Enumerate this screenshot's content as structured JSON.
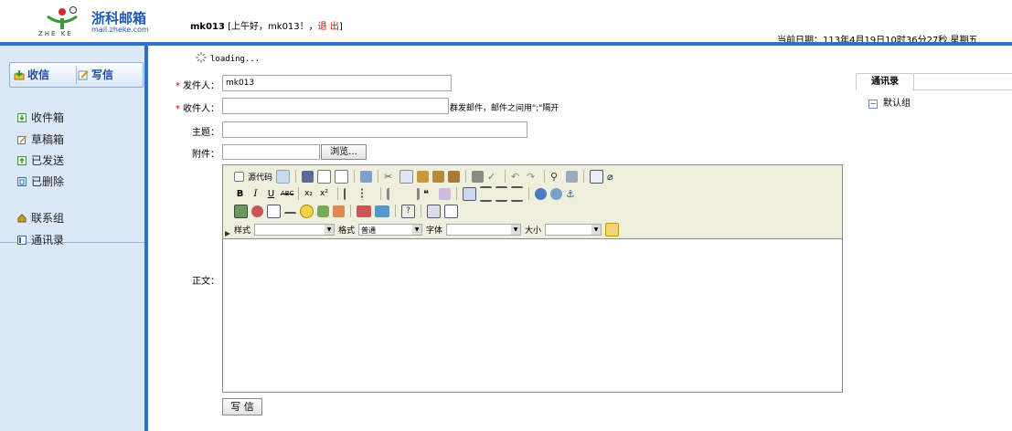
{
  "header": {
    "brand": "浙科邮箱",
    "domain": "mail.zheke.com",
    "logo_sub": "ZHE KE",
    "user": "mk013",
    "greeting": " [上午好，mk013！，",
    "logout": "退 出",
    "greeting_end": "]",
    "date_label": "当前日期：",
    "date_value": "113年4月19日10时36分27秒 星期五"
  },
  "sidebar": {
    "receive_label": "收信",
    "write_label": "写信",
    "folders": [
      {
        "label": "收件箱",
        "icon": "inbox-icon",
        "color": "#3a9a3a"
      },
      {
        "label": "草稿箱",
        "icon": "drafts-icon",
        "color": "#d28a1c"
      },
      {
        "label": "已发送",
        "icon": "sent-icon",
        "color": "#3a9a3a"
      },
      {
        "label": "已删除",
        "icon": "trash-icon",
        "color": "#2a7ab8"
      }
    ],
    "links": [
      {
        "label": "联系组",
        "icon": "contact-group-icon"
      },
      {
        "label": "通讯录",
        "icon": "address-book-icon"
      }
    ]
  },
  "form": {
    "loading": "loading...",
    "from_label": "发件人：",
    "from_value": "mk013",
    "to_label": "收件人：",
    "to_value": "",
    "to_hint": "群发邮件，邮件之间用\";\"隔开",
    "subject_label": "主题：",
    "subject_value": "",
    "attach_label": "附件：",
    "browse_label": "浏览...",
    "body_label": "正文：",
    "send_label": "写 信"
  },
  "editor": {
    "source_label": "源代码",
    "style_label": "样式",
    "style_value": "",
    "format_label": "格式",
    "format_value": "普通",
    "font_label": "字体",
    "font_value": "",
    "size_label": "大小",
    "size_value": ""
  },
  "contacts": {
    "tab_label": "通讯录",
    "group_label": "默认组"
  },
  "colors": {
    "accent": "#2b73c9",
    "sidebar_bg": "#dbe8f8",
    "toolbar_bg": "#efefde",
    "required": "#e00000"
  }
}
